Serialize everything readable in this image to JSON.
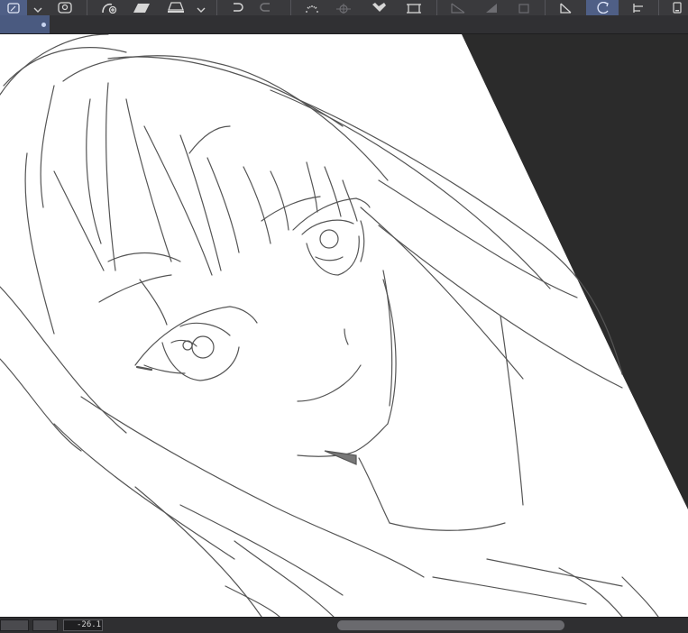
{
  "toolbar": {
    "items": [
      {
        "id": "layer-pen",
        "icon": "pen-layer-icon",
        "active": true
      },
      {
        "id": "dropdown-1",
        "icon": "chevron-down-icon"
      },
      {
        "id": "layer-property",
        "icon": "layer-property-icon"
      },
      {
        "id": "transform-tool",
        "icon": "transform-add-icon"
      },
      {
        "id": "fill-tool",
        "icon": "parallelogram-fill-icon"
      },
      {
        "id": "eraser-tool",
        "icon": "eraser-icon"
      },
      {
        "id": "dropdown-2",
        "icon": "chevron-down-icon"
      },
      {
        "id": "undo",
        "icon": "undo-icon"
      },
      {
        "id": "redo",
        "icon": "redo-icon"
      },
      {
        "id": "loading",
        "icon": "spinner-icon"
      },
      {
        "id": "snap",
        "icon": "crosshair-icon"
      },
      {
        "id": "fill-bucket",
        "icon": "fill-bucket-icon"
      },
      {
        "id": "crop",
        "icon": "crop-icon"
      },
      {
        "id": "ruler-1",
        "icon": "ruler-icon"
      },
      {
        "id": "tone",
        "icon": "tone-icon"
      },
      {
        "id": "square",
        "icon": "square-icon"
      },
      {
        "id": "perspective",
        "icon": "perspective-icon"
      },
      {
        "id": "rotate-canvas",
        "icon": "rotate-canvas-icon",
        "active": true
      },
      {
        "id": "align",
        "icon": "align-icon"
      },
      {
        "id": "device",
        "icon": "device-icon"
      }
    ]
  },
  "canvas": {
    "tab_icon": "unsaved-dot-icon",
    "paper_color": "#ffffff",
    "line_color": "#555555",
    "background_color": "#2b2b2b"
  },
  "status": {
    "rotation_value": "-26.1"
  },
  "colors": {
    "accent": "#4f5f86",
    "toolbar_bg": "#3a3a3d"
  }
}
